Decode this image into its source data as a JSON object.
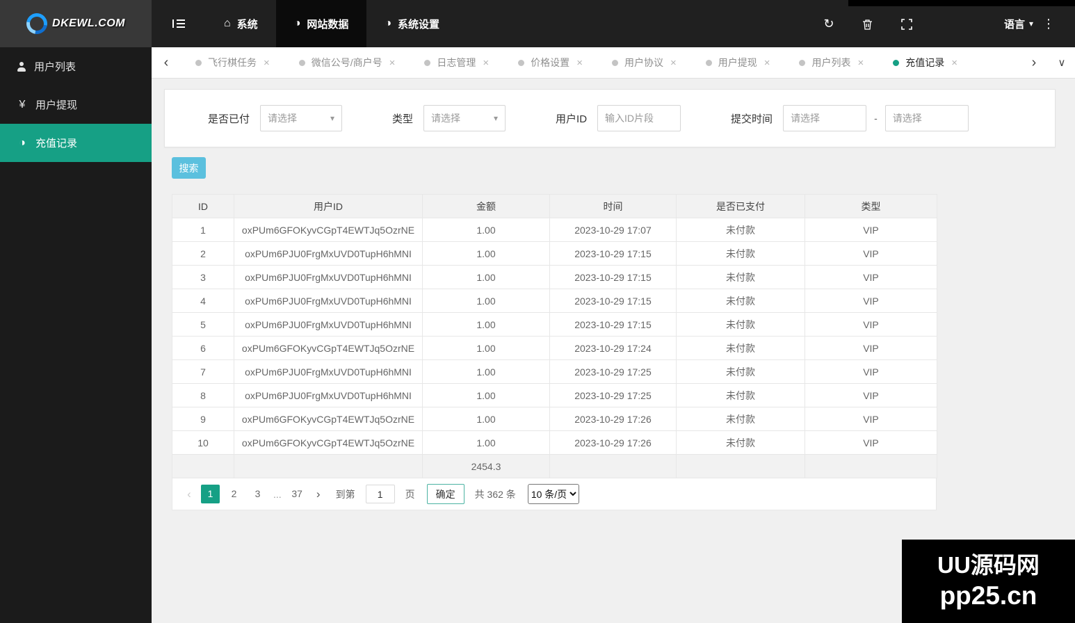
{
  "colors": {
    "accent_teal": "#16a085",
    "search_button_blue": "#5bc0de",
    "topbar_bg": "#202020",
    "sidebar_bg": "#1b1b1b",
    "watermark_bg": "#000000"
  },
  "icons": {
    "home": "⌂",
    "half_circle": "◑",
    "refresh": "↻",
    "caret_down": "▾",
    "dots_vertical": "⋮",
    "yen": "¥",
    "chevron_left": "‹",
    "chevron_right": "›",
    "chevron_down": "∨",
    "close": "×"
  },
  "topbar": {
    "nav_items": [
      {
        "label": "系统"
      },
      {
        "label": "网站数据"
      },
      {
        "label": "系统设置"
      }
    ],
    "language": "语言"
  },
  "sidebar": {
    "logo_text": "DKEWL.COM",
    "items": [
      {
        "label": "用户列表"
      },
      {
        "label": "用户提现"
      },
      {
        "label": "充值记录"
      }
    ]
  },
  "tabs": [
    "飞行棋任务",
    "微信公号/商户号",
    "日志管理",
    "价格设置",
    "用户协议",
    "用户提现",
    "用户列表",
    "充值记录"
  ],
  "filters": {
    "paid_label": "是否已付",
    "paid_value": "请选择",
    "type_label": "类型",
    "type_value": "请选择",
    "userid_label": "用户ID",
    "userid_placeholder": "输入ID片段",
    "time_label": "提交时间",
    "time_from_placeholder": "请选择",
    "separator": "-",
    "time_to_placeholder": "请选择",
    "search_label": "搜索"
  },
  "table": {
    "headers": [
      "ID",
      "用户ID",
      "金额",
      "时间",
      "是否已支付",
      "类型"
    ],
    "rows": [
      [
        "1",
        "oxPUm6GFOKyvCGpT4EWTJq5OzrNE",
        "1.00",
        "2023-10-29 17:07",
        "未付款",
        "VIP"
      ],
      [
        "2",
        "oxPUm6PJU0FrgMxUVD0TupH6hMNI",
        "1.00",
        "2023-10-29 17:15",
        "未付款",
        "VIP"
      ],
      [
        "3",
        "oxPUm6PJU0FrgMxUVD0TupH6hMNI",
        "1.00",
        "2023-10-29 17:15",
        "未付款",
        "VIP"
      ],
      [
        "4",
        "oxPUm6PJU0FrgMxUVD0TupH6hMNI",
        "1.00",
        "2023-10-29 17:15",
        "未付款",
        "VIP"
      ],
      [
        "5",
        "oxPUm6PJU0FrgMxUVD0TupH6hMNI",
        "1.00",
        "2023-10-29 17:15",
        "未付款",
        "VIP"
      ],
      [
        "6",
        "oxPUm6GFOKyvCGpT4EWTJq5OzrNE",
        "1.00",
        "2023-10-29 17:24",
        "未付款",
        "VIP"
      ],
      [
        "7",
        "oxPUm6PJU0FrgMxUVD0TupH6hMNI",
        "1.00",
        "2023-10-29 17:25",
        "未付款",
        "VIP"
      ],
      [
        "8",
        "oxPUm6PJU0FrgMxUVD0TupH6hMNI",
        "1.00",
        "2023-10-29 17:25",
        "未付款",
        "VIP"
      ],
      [
        "9",
        "oxPUm6GFOKyvCGpT4EWTJq5OzrNE",
        "1.00",
        "2023-10-29 17:26",
        "未付款",
        "VIP"
      ],
      [
        "10",
        "oxPUm6GFOKyvCGpT4EWTJq5OzrNE",
        "1.00",
        "2023-10-29 17:26",
        "未付款",
        "VIP"
      ]
    ],
    "total_amount": "2454.3"
  },
  "pagination": {
    "pages": [
      "1",
      "2",
      "3",
      "...",
      "37"
    ],
    "active_page": "1",
    "goto_label": "到第",
    "goto_value": "1",
    "unit_label": "页",
    "confirm_label": "确定",
    "total_text": "共 362 条",
    "page_size_option": "10 条/页"
  },
  "watermark": {
    "line1": "UU源码网",
    "line2": "pp25.cn"
  }
}
